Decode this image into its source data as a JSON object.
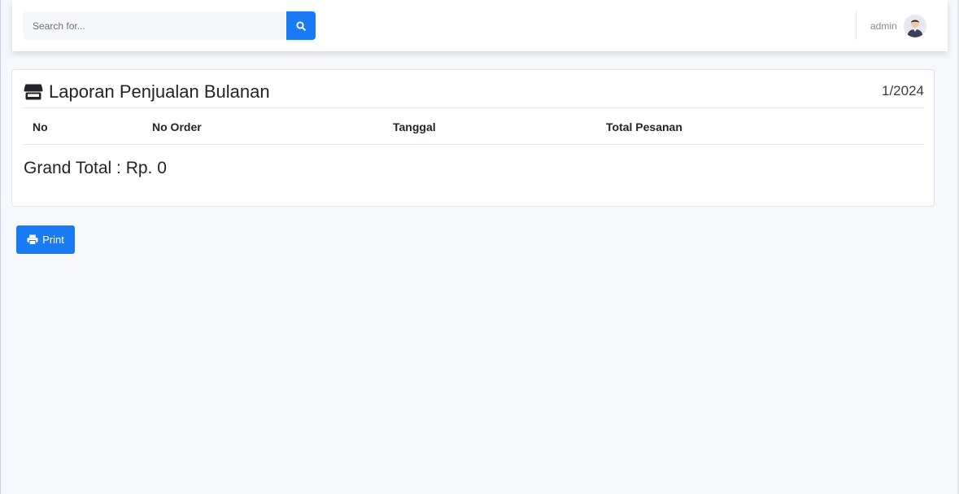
{
  "search": {
    "placeholder": "Search for...",
    "button_icon": "search-icon"
  },
  "user": {
    "name": "admin",
    "avatar_icon": "user-avatar"
  },
  "report": {
    "icon": "store-icon",
    "title": "Laporan Penjualan Bulanan",
    "period": "1/2024",
    "columns": [
      "No",
      "No Order",
      "Tanggal",
      "Total Pesanan"
    ],
    "rows": [],
    "grand_total_label": "Grand Total : ",
    "grand_total_value": "Rp. 0"
  },
  "actions": {
    "print_label": "Print",
    "print_icon": "print-icon"
  },
  "colors": {
    "primary": "#1a7cf5",
    "background": "#f7f8fc",
    "topbar": "#ffffff",
    "text": "#212529",
    "muted": "#858796"
  }
}
